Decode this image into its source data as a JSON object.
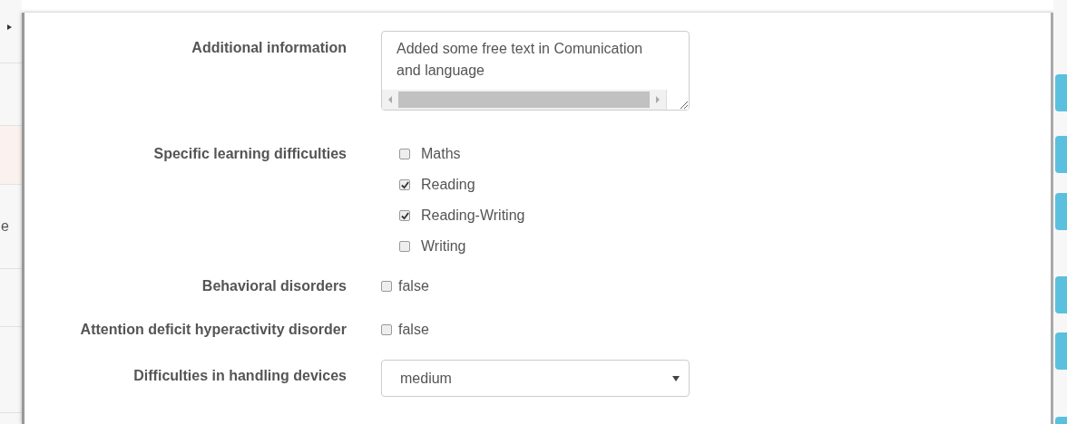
{
  "background": {
    "row_fragment": "e"
  },
  "fields": [
    {
      "kind": "textarea",
      "label": "Additional information",
      "value": "Added some free text in Comunication and language"
    },
    {
      "kind": "checkbox_group",
      "label": "Specific learning difficulties",
      "options": [
        {
          "label": "Maths",
          "checked": false
        },
        {
          "label": "Reading",
          "checked": true
        },
        {
          "label": "Reading-Writing",
          "checked": true
        },
        {
          "label": "Writing",
          "checked": false
        }
      ]
    },
    {
      "kind": "checkbox",
      "label": "Behavioral disorders",
      "text": "false",
      "checked": false
    },
    {
      "kind": "checkbox",
      "label": "Attention deficit hyperactivity disorder",
      "text": "false",
      "checked": false
    },
    {
      "kind": "select",
      "label": "Difficulties in handling devices",
      "value": "medium"
    }
  ]
}
